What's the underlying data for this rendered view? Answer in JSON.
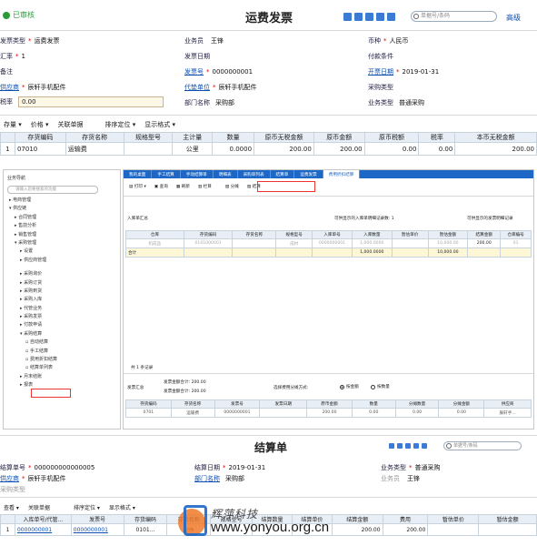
{
  "top": {
    "status": "已审核",
    "title": "运费发票",
    "search_placeholder": "单据号/条码",
    "advanced": "高级",
    "fields": {
      "invoice_type_label": "发票类型",
      "invoice_type_value": "运费发票",
      "salesman_label": "业务员",
      "salesman_value": "王锋",
      "currency_label": "币种",
      "currency_value": "人民币",
      "rate_label": "汇率",
      "rate_value": "1",
      "invoice_date_label": "发票日期",
      "payment_terms_label": "付款条件",
      "remark_label": "备注",
      "invoice_no_label": "发票号",
      "invoice_no_value": "0000000001",
      "open_date_label": "开票日期",
      "open_date_value": "2019-01-31",
      "supplier_label": "供应商",
      "supplier_value": "辰轩手机配件",
      "agent_label": "代垫单位",
      "agent_value": "辰轩手机配件",
      "purchase_type_label": "采购类型",
      "tax_rate_label": "税率",
      "tax_rate_value": "0.00",
      "dept_label": "部门名称",
      "dept_value": "采购部",
      "biz_type_label": "业务类型",
      "biz_type_value": "普通采购"
    },
    "toolbar": [
      "存量",
      "价格",
      "关联单据",
      "排序定位",
      "显示格式"
    ],
    "columns": [
      "",
      "存货编码",
      "存货名称",
      "规格型号",
      "主计量",
      "数量",
      "原币无税金额",
      "原币金额",
      "原币税额",
      "税率",
      "本币无税金额"
    ],
    "rows": [
      [
        "1",
        "07010",
        "运输费",
        "",
        "公里",
        "0.0000",
        "200.00",
        "200.00",
        "0.00",
        "0.00",
        "200.00"
      ]
    ]
  },
  "middle": {
    "sidebar_title": "业务导航",
    "sidebar_search": "请输入您要搜索的功能",
    "tree": [
      "电商管理",
      "供应链",
      "合同管理",
      "售前分析",
      "销售管理",
      "采购管理",
      "设置",
      "供应商管理",
      "采购询价",
      "采购订货",
      "采购到货",
      "采购入库",
      "代管业务",
      "采购发票",
      "付款申请",
      "采购结算",
      "自动结算",
      "手工结算",
      "费用折扣结算",
      "结算单列表",
      "月末结账",
      "报表"
    ],
    "tabs": [
      "我的桌面",
      "手工结算",
      "手动结算单",
      "明细表",
      "采购单列表",
      "结算单",
      "运费发票",
      "费用折扣结算"
    ],
    "toolbar": [
      "打印",
      "查询",
      "刷新",
      "栏目",
      "分摊",
      "结算"
    ],
    "inbound_summary": "入库单汇总",
    "inbound_count": "可供显示的入库单明细记录数: 1",
    "inbound_count2": "可供显示的发票明细记录",
    "inbound_cols": [
      "仓库",
      "存货编码",
      "存货名称",
      "规格型号",
      "入库单号",
      "入库数量",
      "暂估单价",
      "暂估金额",
      "结算金额",
      "仓库编号"
    ],
    "inbound_row": [
      "机成品",
      "0101000001",
      "",
      "成材",
      "0000000001",
      "1,000.0000",
      "",
      "10,000.00",
      "200.00",
      "01"
    ],
    "inbound_total": [
      "合计",
      "",
      "",
      "",
      "",
      "1,000.0000",
      "",
      "10,000.00",
      "",
      ""
    ],
    "record_count": "共 1 条记录",
    "expense_summary": "发票汇总",
    "expense_total": "发票金额合计: 200.00",
    "expense_amount_total": "发票金额合计: 200.00",
    "allocation_label": "选择费用分摊方式:",
    "allocation_by_amount": "按金额",
    "allocation_by_qty": "按数量",
    "expense_cols": [
      "存货编码",
      "存货名称",
      "发票号",
      "发票日期",
      "原币金额",
      "数量",
      "分摊数量",
      "分摊金额",
      "供应商"
    ],
    "expense_row": [
      "0701",
      "运输费",
      "0000000001",
      "",
      "200.00",
      "0.00",
      "0.00",
      "0.00",
      "辰轩手..."
    ]
  },
  "bottom": {
    "title": "结算单",
    "search_placeholder": "单据号/条码",
    "fields": {
      "settle_no_label": "结算单号",
      "settle_no_value": "000000000000005",
      "settle_date_label": "结算日期",
      "settle_date_value": "2019-01-31",
      "biz_type_label": "业务类型",
      "biz_type_value": "普通采购",
      "supplier_label": "供应商",
      "supplier_value": "辰轩手机配件",
      "dept_label": "部门名称",
      "dept_value": "采购部",
      "salesman_label": "业务员",
      "salesman_value": "王锋",
      "purchase_type_label": "采购类型"
    },
    "toolbar": [
      "查看",
      "关联单据",
      "排序定位",
      "显示格式"
    ],
    "columns": [
      "",
      "入库单号/代管...",
      "发票号",
      "存货编码",
      "存货名称",
      "规格型号",
      "结算数量",
      "结算单价",
      "结算金额",
      "费用",
      "暂估单价",
      "暂估金额"
    ],
    "rows": [
      [
        "1",
        "0000000001",
        "0000000001",
        "0101...",
        "配件",
        "",
        "",
        "",
        "200.00",
        "200.00",
        "",
        ""
      ]
    ]
  },
  "watermark": {
    "brand_cn": "辉萍科技",
    "url": "www.yonyou.org.cn"
  }
}
